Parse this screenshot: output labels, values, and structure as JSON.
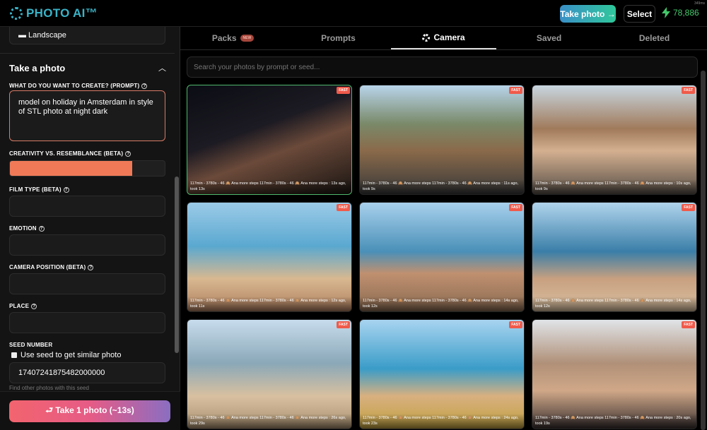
{
  "header": {
    "logo": "PHOTO AI™",
    "take_photo": "Take photo →",
    "select": "Select",
    "credits": "78,886",
    "timing": "349ms"
  },
  "sidebar": {
    "orientation_value": "▬ Landscape",
    "section_title": "Take a photo",
    "prompt_label": "WHAT DO YOU WANT TO CREATE? (PROMPT)",
    "prompt_value": "model on holiday in Amsterdam in style of STL photo at night dark",
    "creativity_label": "CREATIVITY VS. RESEMBLANCE (BETA)",
    "creativity_percent": 79,
    "film_label": "FILM TYPE (BETA)",
    "emotion_label": "EMOTION",
    "camera_label": "CAMERA POSITION (BETA)",
    "place_label": "PLACE",
    "seed_label": "SEED NUMBER",
    "seed_checkbox": "Use seed to get similar photo",
    "seed_value": "17407241875482000000",
    "seed_hint": "Find other photos with this seed",
    "submit": "⮐ Take 1 photo (~13s)"
  },
  "tabs": [
    {
      "label": "Packs",
      "badge": "NEW"
    },
    {
      "label": "Prompts"
    },
    {
      "label": "Camera"
    },
    {
      "label": "Saved"
    },
    {
      "label": "Deleted"
    }
  ],
  "search_placeholder": "Search your photos by prompt or seed...",
  "photos": [
    {
      "badge": "FAST",
      "caption": "117min - 3780s - 46 🙈 Ana more steps 117min - 3780s - 46 🙈 Ana more steps : 13s ago, took 13s"
    },
    {
      "badge": "FAST",
      "caption": "117min - 3780s - 46 🙈 Ana more steps 117min - 3780s - 46 🙈 Ana more steps : 11s ago, took 9s"
    },
    {
      "badge": "FAST",
      "caption": "117min - 3780s - 46 🙈 Ana more steps 117min - 3780s - 46 🙈 Ana more steps : 10s ago, took 9s"
    },
    {
      "badge": "FAST",
      "caption": "117min - 3780s - 46 🙈 Ana more steps 117min - 3780s - 46 🙈 Ana more steps : 12s ago, took 11s"
    },
    {
      "badge": "FAST",
      "caption": "117min - 3780s - 46 🙈 Ana more steps 117min - 3780s - 46 🙈 Ana more steps : 14s ago, took 12s"
    },
    {
      "badge": "FAST",
      "caption": "117min - 3780s - 46 🙈 Ana more steps 117min - 3780s - 46 🙈 Ana more steps : 14s ago, took 12s"
    },
    {
      "badge": "FAST",
      "caption": "117min - 3780s - 46 🙈 Ana more steps 117min - 3780s - 46 🙈 Ana more steps : 26s ago, took 29s"
    },
    {
      "badge": "FAST",
      "caption": "117min - 3780s - 46 🙈 Ana more steps 117min - 3780s - 46 🙈 Ana more steps : 24s ago, took 23s"
    },
    {
      "badge": "FAST",
      "caption": "117min - 3780s - 46 🙈 Ana more steps 117min - 3780s - 46 🙈 Ana more steps : 20s ago, took 19s"
    }
  ]
}
